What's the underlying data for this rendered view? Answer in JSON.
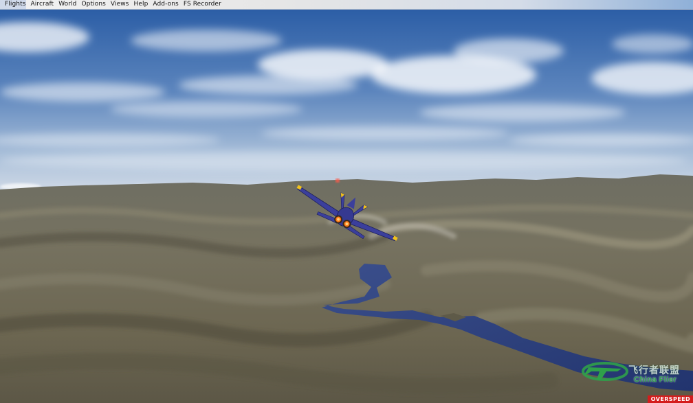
{
  "menu": {
    "items": [
      "Flights",
      "Aircraft",
      "World",
      "Options",
      "Views",
      "Help",
      "Add-ons",
      "FS Recorder"
    ]
  },
  "watermark": {
    "chinese_text": "飞行者联盟",
    "english_text": "China Flier",
    "color": "#2fa04a"
  },
  "status": {
    "warning_label": "OVERSPEED",
    "warning_color": "#d41c1c"
  },
  "scene": {
    "sky_top": "#2f62a8",
    "sky_horizon": "#c9d6e6",
    "terrain": "#6b6752",
    "water": "#2a3d78",
    "aircraft_color": "#3a3f9e",
    "aircraft_accent": "#f2c21a"
  }
}
